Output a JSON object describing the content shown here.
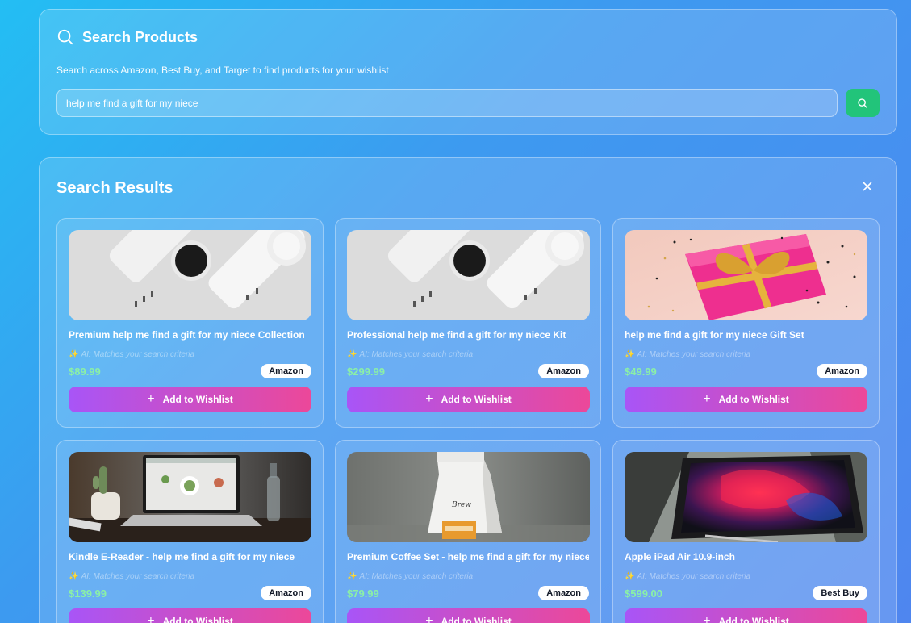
{
  "search": {
    "title": "Search Products",
    "subtitle": "Search across Amazon, Best Buy, and Target to find products for your wishlist",
    "query": "help me find a gift for my niece",
    "icon": "search-icon"
  },
  "results": {
    "title": "Search Results",
    "close_icon": "close-icon",
    "ai_spark_icon": "sparkles-icon",
    "add_icon": "plus-icon",
    "items": [
      {
        "name": "Premium help me find a gift for my niece Collection",
        "ai_note": "AI: Matches your search criteria",
        "price": "$89.99",
        "store": "Amazon",
        "button": "Add to Wishlist",
        "image": "white smartwatches on white surface"
      },
      {
        "name": "Professional help me find a gift for my niece Kit",
        "ai_note": "AI: Matches your search criteria",
        "price": "$299.99",
        "store": "Amazon",
        "button": "Add to Wishlist",
        "image": "white smartwatches on white surface"
      },
      {
        "name": "help me find a gift for my niece Gift Set",
        "ai_note": "AI: Matches your search criteria",
        "price": "$49.99",
        "store": "Amazon",
        "button": "Add to Wishlist",
        "image": "pink gift box with gold ribbon"
      },
      {
        "name": "Kindle E-Reader - help me find a gift for my niece",
        "ai_note": "AI: Matches your search criteria",
        "price": "$139.99",
        "store": "Amazon",
        "button": "Add to Wishlist",
        "image": "laptop on desk with cactus"
      },
      {
        "name": "Premium Coffee Set - help me find a gift for my niece",
        "ai_note": "AI: Matches your search criteria",
        "price": "$79.99",
        "store": "Amazon",
        "button": "Add to Wishlist",
        "image": "coffee bag"
      },
      {
        "name": "Apple iPad Air 10.9-inch",
        "ai_note": "AI: Matches your search criteria",
        "price": "$599.00",
        "store": "Best Buy",
        "button": "Add to Wishlist",
        "image": "tablet with colorful wallpaper"
      }
    ]
  }
}
